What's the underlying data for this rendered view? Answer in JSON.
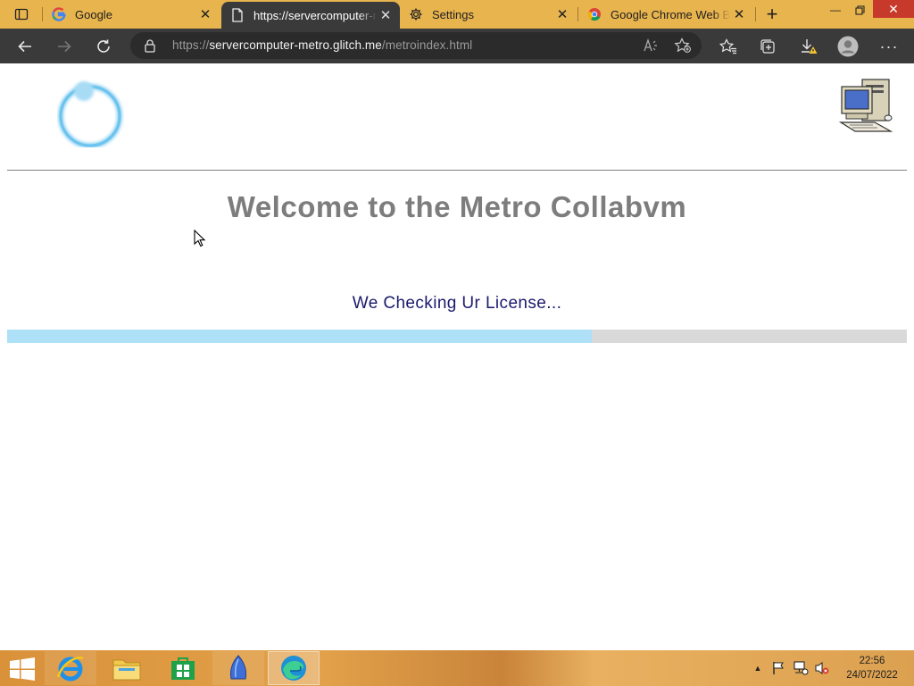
{
  "browser": {
    "tabs": [
      {
        "label": "Google",
        "icon": "google-icon",
        "active": false
      },
      {
        "label": "https://servercomputer-metro.glitch.me/metroindex.html",
        "icon": "page-icon",
        "active": true
      },
      {
        "label": "Settings",
        "icon": "gear-icon",
        "active": false
      },
      {
        "label": "Google Chrome Web Browser",
        "icon": "chrome-icon",
        "active": false
      }
    ],
    "address": {
      "scheme": "https://",
      "host": "servercomputer-metro.glitch.me",
      "path": "/metroindex.html"
    },
    "accent_color": "#e8b44e",
    "toolbar_color": "#3a3a3a"
  },
  "page": {
    "heading": "Welcome to the Metro Collabvm",
    "status": "We Checking Ur License...",
    "progress_fraction": 0.65,
    "progress_color": "#aee0f7",
    "heading_color": "#7d7d7d",
    "status_color": "#1a1a6e"
  },
  "taskbar": {
    "apps": [
      {
        "name": "internet-explorer",
        "active": false
      },
      {
        "name": "file-explorer",
        "active": false
      },
      {
        "name": "store",
        "active": false
      },
      {
        "name": "blue-app",
        "active": false
      },
      {
        "name": "edge",
        "active": true
      }
    ],
    "clock": {
      "time": "22:56",
      "date": "24/07/2022"
    }
  }
}
